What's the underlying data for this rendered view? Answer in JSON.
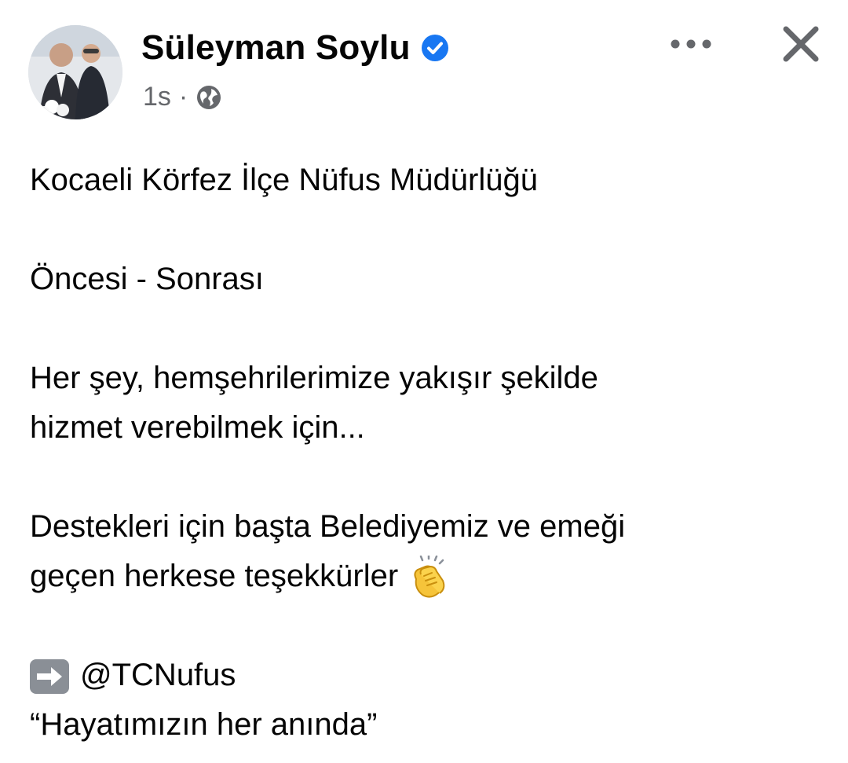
{
  "post": {
    "author": "Süleyman Soylu",
    "verified": true,
    "time": "1s",
    "separator": "·",
    "privacy_icon": "globe-icon",
    "actions": {
      "more_icon": "more-horizontal-icon",
      "close_icon": "close-icon"
    },
    "lines": {
      "l1": "Kocaeli Körfez İlçe Nüfus Müdürlüğü",
      "l2": "Öncesi - Sonrası",
      "l3": "Her şey, hemşehrilerimize yakışır şekilde",
      "l4": "hizmet verebilmek için...",
      "l5": "Destekleri için başta Belediyemiz ve emeği",
      "l6": "geçen herkese teşekkürler",
      "l7": "@TCNufus",
      "l8": "“Hayatımızın her anında”"
    },
    "emojis": {
      "clap": "clapping-hands-emoji",
      "arrow": "right-arrow-emoji"
    }
  },
  "colors": {
    "verified_blue": "#1877f2",
    "secondary_text": "#65676b",
    "primary_text": "#050505"
  }
}
